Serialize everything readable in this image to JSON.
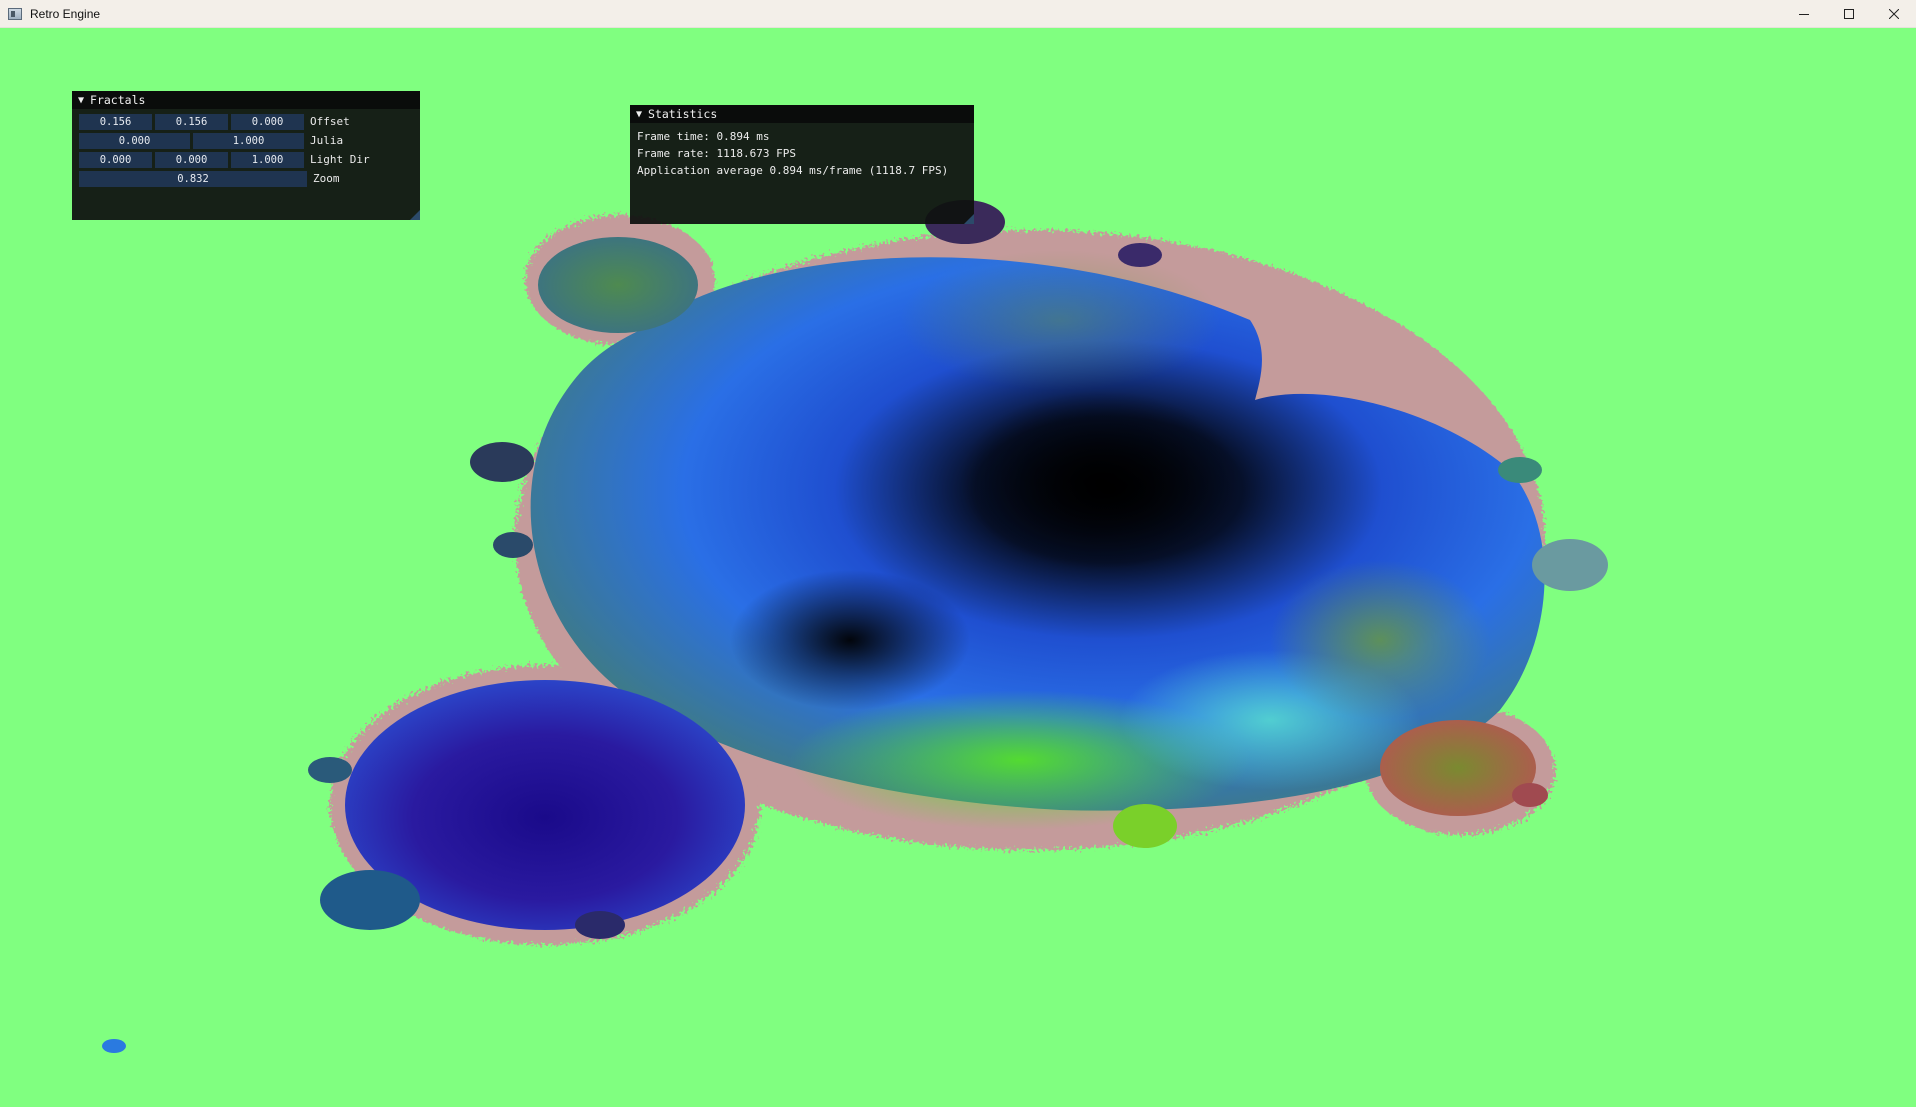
{
  "window": {
    "title": "Retro Engine",
    "controls": [
      "minimize-icon",
      "maximize-icon",
      "close-icon"
    ]
  },
  "colors": {
    "background": "#80ff80",
    "panel_bg": "#0f1210",
    "field_bg": "#1f3450"
  },
  "fractals_panel": {
    "title": "Fractals",
    "rows": [
      {
        "label": "Offset",
        "values": [
          "0.156",
          "0.156",
          "0.000"
        ]
      },
      {
        "label": "Julia",
        "values": [
          "0.000",
          "1.000"
        ]
      },
      {
        "label": "Light Dir",
        "values": [
          "0.000",
          "0.000",
          "1.000"
        ]
      },
      {
        "label": "Zoom",
        "values": [
          "0.832"
        ]
      }
    ]
  },
  "statistics_panel": {
    "title": "Statistics",
    "lines": [
      "Frame time: 0.894 ms",
      "Frame rate: 1118.673 FPS",
      "Application average 0.894 ms/frame (1118.7 FPS)"
    ]
  }
}
